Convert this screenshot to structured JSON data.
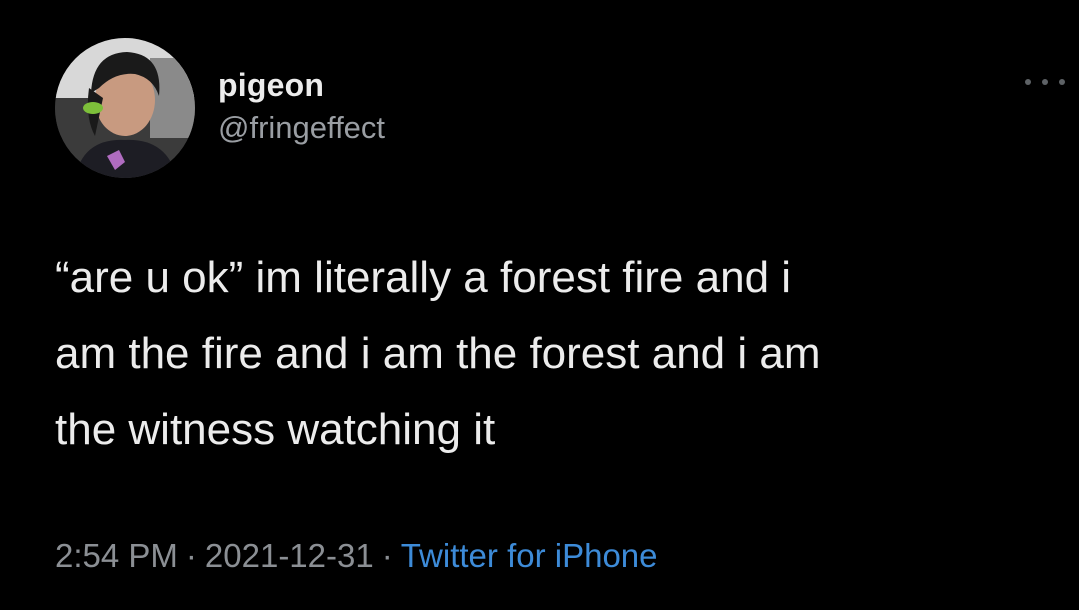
{
  "user": {
    "display_name": "pigeon",
    "handle": "@fringeffect"
  },
  "tweet": {
    "text": "“are u ok” im literally a forest fire and i\nam the fire and i am the forest and i am\nthe witness watching it",
    "time": "2:54 PM",
    "date": "2021-12-31",
    "source": "Twitter for iPhone",
    "separator": "·"
  },
  "icons": {
    "more": "more-dots-icon"
  },
  "colors": {
    "background": "#000000",
    "text": "#ececec",
    "muted": "#8b8f94",
    "link": "#3d8bd8"
  }
}
